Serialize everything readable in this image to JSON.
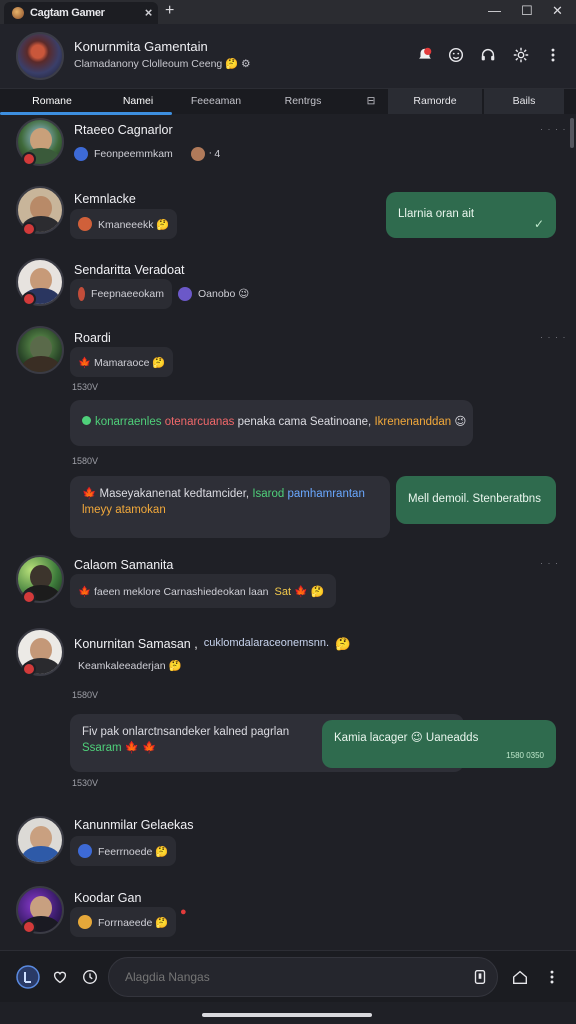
{
  "window": {
    "tab_title": "Cagtam Gamer",
    "tab_close": "×",
    "new_tab": "+",
    "minimize": "—",
    "maximize": "☐",
    "close": "✕"
  },
  "header": {
    "title": "Konurnmita Gamentain",
    "subtitle": "Clamadanony Clolleoum Ceeng 🤔 ⚙",
    "icons": [
      "bell-icon",
      "emoji-icon",
      "headset-icon",
      "settings-gear-icon",
      "more-vertical-icon"
    ]
  },
  "tabs": [
    {
      "label": "Romane",
      "active": true
    },
    {
      "label": "Namei"
    },
    {
      "label": "Feeeaman"
    },
    {
      "label": "Rentrgs"
    },
    {
      "label": "⊟"
    },
    {
      "label": "Ramorde",
      "filled": true
    },
    {
      "label": "Bails",
      "filled": true
    }
  ],
  "chats": [
    {
      "name": "Rtaeeo Cagnarlor",
      "chip": "Feonpeemmkam",
      "extra": "ᐧ 4",
      "dots": "· · · ·"
    },
    {
      "name": "Kemnlacke",
      "chip": "Kmaneeekk 🤔",
      "reply": "Llarnia oran ait",
      "reply_check": "✓"
    },
    {
      "name": "Sendaritta Veradoat",
      "chip": "Feepnaeeokam",
      "extra": "Oanobo 😉"
    },
    {
      "name": "Roardi",
      "chip": "🍁 Mamaraoce 🤔",
      "dots": "· · · ·"
    },
    {
      "timestamp": "1530V",
      "msg": {
        "green": "konarraenles",
        "red": "otenarcuanas",
        "mid": "penaka cama Seatinoane,",
        "orange": "Ikrenenanddan",
        "emoji": "😉"
      }
    },
    {
      "timestamp": "1580V",
      "msg2": {
        "prefix": "🍁 Maseyakanenat kedtamcider,",
        "green": "Isarod",
        "blue": "pamhamrantan",
        "orange": "lmeyy atamokan"
      },
      "reply": "Mell demoil. Stenberatbns"
    },
    {
      "name": "Calaom Samanita",
      "chip": "🍁 faeen meklore Carnashiedeokan laan",
      "extra": "Sat 🍁 🤔",
      "dots": "· · ·"
    },
    {
      "name": "Konurnitan Samasan ,",
      "name_extra": "cuklomdalaraceonemsnn.",
      "emoji": "🤔",
      "chip": "Keamkaleeaderjan 🤔"
    },
    {
      "timestamp": "1580V",
      "msg3": {
        "text": "Fiv pak onlarctnsandeker kalned pagrlan",
        "green": "Ssaram 🍁 🍁"
      },
      "reply": "Kamia lacager 😉 Uaneadds",
      "reply_time": "1580 0350"
    },
    {
      "timestamp": "1530V"
    },
    {
      "name": "Kanunmilar Gelaekas",
      "chip": "Feerrnoede 🤔"
    },
    {
      "name": "Koodar Gan",
      "chip": "Forrnaeede 🤔",
      "extra": "●"
    }
  ],
  "composer": {
    "placeholder": "Alagdia Nangas",
    "icons": [
      "app-logo-icon",
      "heart-icon",
      "clock-icon",
      "attach-icon",
      "home-icon",
      "more-vertical-icon"
    ]
  },
  "colors": {
    "accent": "#3d8fe0",
    "outgoing_bubble": "#2f6b4e",
    "badge_red": "#d23a3a",
    "background": "#1f2026"
  }
}
